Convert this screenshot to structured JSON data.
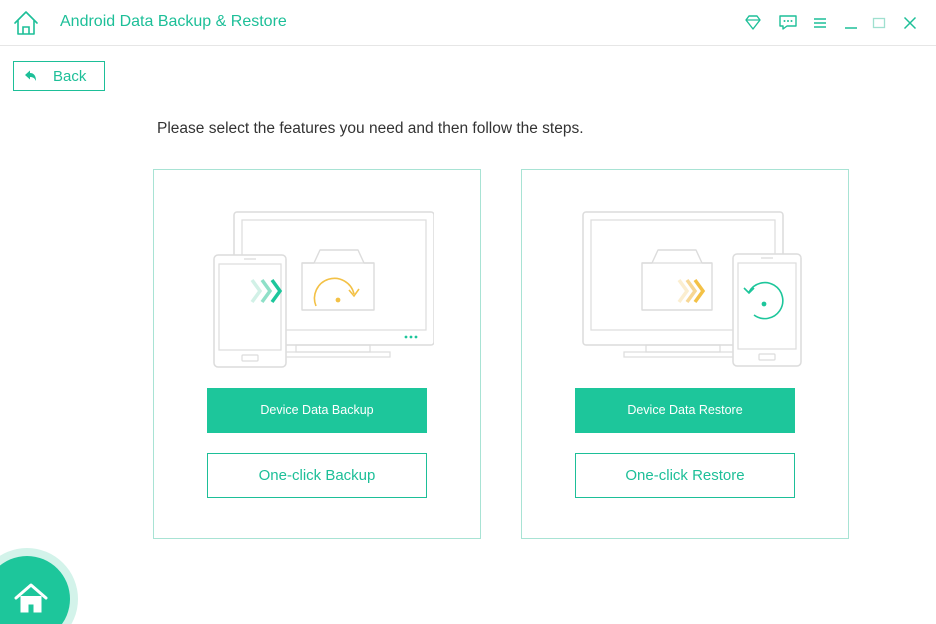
{
  "app": {
    "title": "Android Data Backup & Restore",
    "accent_color": "#1dc69b",
    "icons": [
      "home-icon",
      "diamond-icon",
      "chat-icon",
      "menu-icon",
      "minimize-icon",
      "maximize-icon",
      "close-icon"
    ]
  },
  "back": {
    "label": "Back",
    "icon": "back-arrow-icon"
  },
  "instruction": "Please select the features you need and then follow the steps.",
  "panels": [
    {
      "id": "backup",
      "illustration": "phone-to-monitor-backup",
      "primary_label": "Device Data Backup",
      "secondary_label": "One-click Backup"
    },
    {
      "id": "restore",
      "illustration": "monitor-to-phone-restore",
      "primary_label": "Device Data Restore",
      "secondary_label": "One-click Restore"
    }
  ],
  "fab": {
    "icon": "home-icon"
  }
}
